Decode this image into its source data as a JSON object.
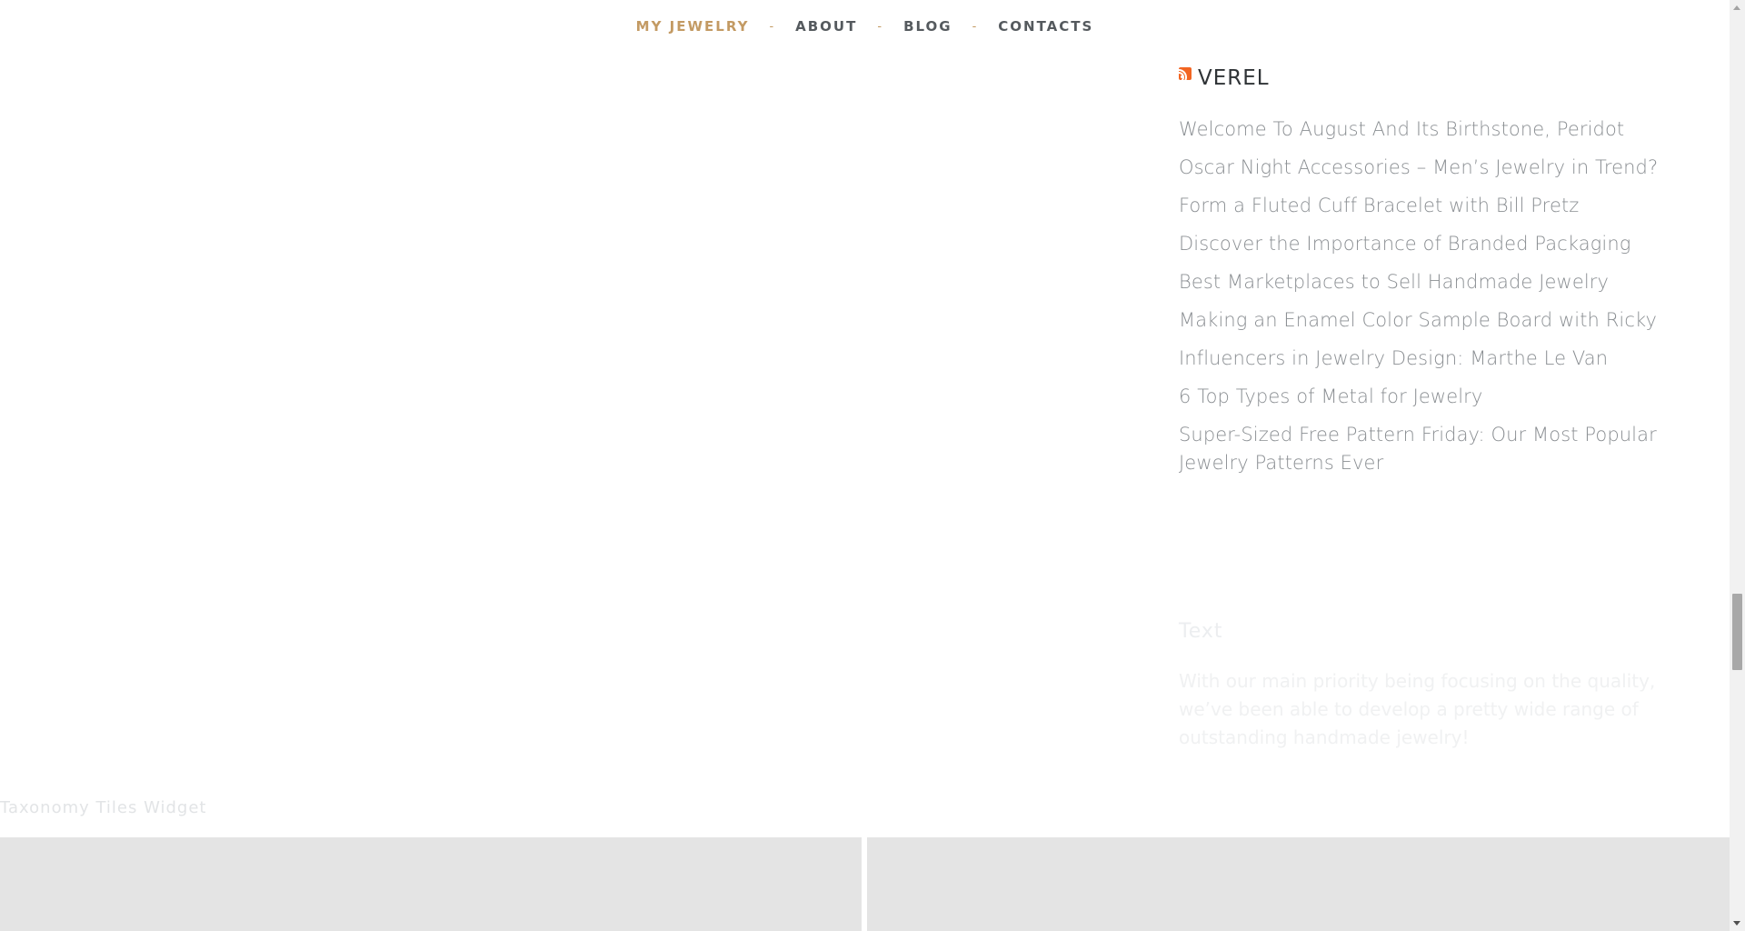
{
  "nav": {
    "items": [
      {
        "label": "MY JEWELRY",
        "active": true
      },
      {
        "label": "ABOUT",
        "active": false
      },
      {
        "label": "BLOG",
        "active": false
      },
      {
        "label": "CONTACTS",
        "active": false
      }
    ],
    "separator": "-"
  },
  "rss_widget": {
    "icon": "rss-icon",
    "title": "VEREL",
    "items": [
      "Welcome To August And Its Birthstone, Peridot",
      "Oscar Night Accessories – Men’s Jewelry in Trend?",
      "Form a Fluted Cuff Bracelet with Bill Pretz",
      "Discover the Importance of Branded Packaging",
      "Best Marketplaces to Sell Handmade Jewelry",
      "Making an Enamel Color Sample Board with Ricky",
      "Influencers in Jewelry Design: Marthe Le Van",
      "6 Top Types of Metal for Jewelry",
      "Super-Sized Free Pattern Friday: Our Most Popular Jewelry Patterns Ever"
    ]
  },
  "text_widget": {
    "title": "Text",
    "body": "With our main priority being focusing on the quality, we’ve been able to develop a pretty wide range of outstanding handmade jewelry!"
  },
  "taxonomy_widget": {
    "title": "Taxonomy Tiles Widget"
  },
  "colors": {
    "accent": "#c39a63",
    "nav_text": "#555a5e",
    "link_text": "#8b8f93",
    "tile_bg": "#e4e4e4"
  }
}
